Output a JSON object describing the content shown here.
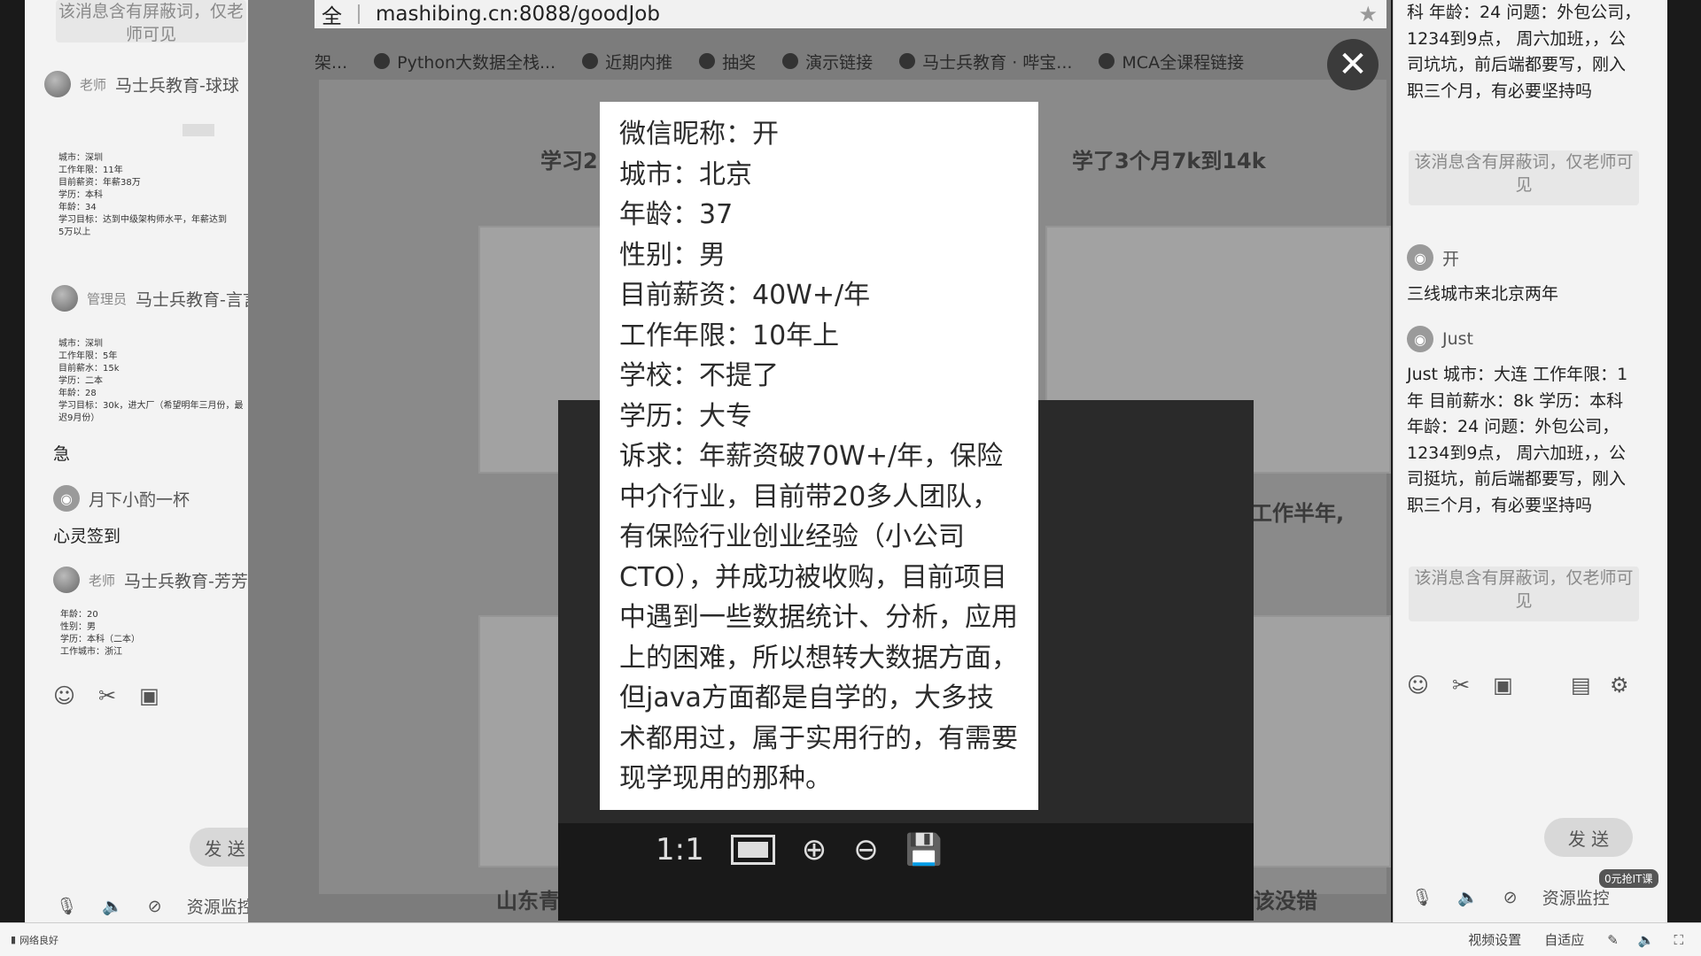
{
  "left_chat": {
    "top_blocked": "该消息含有屏蔽词，仅老师可见",
    "msg1": {
      "role": "老师",
      "name": "马士兵教育-球球"
    },
    "msg1_info": [
      "城市：深圳",
      "工作年限：11年",
      "目前薪资：年薪38万",
      "学历：本科",
      "年龄：34",
      "学习目标：达到中级架构师水平，年薪达到",
      "5万以上"
    ],
    "msg2": {
      "role": "管理员",
      "name": "马士兵教育-言言老..."
    },
    "msg2_info": [
      "城市：深圳",
      "工作年限：5年",
      "目前薪水：15k",
      "学历：二本",
      "年龄：28",
      "学习目标：30k，进大厂（希望明年三月份，最",
      "迟9月份）"
    ],
    "msg3_text": "急",
    "msg4": {
      "name": "月下小酌一杯",
      "text": "心灵签到"
    },
    "msg5": {
      "role": "老师",
      "name": "马士兵教育-芳芳老师..."
    },
    "msg5_info": [
      "年龄：20",
      "性别：男",
      "学历：本科（二本）",
      "工作城市：浙江"
    ],
    "send_label": "发 送",
    "bottom_label": "资源监控"
  },
  "browser": {
    "url": "mashibing.cn:8088/goodJob",
    "left_fragment": "全",
    "bookmarks": [
      "架...",
      "Python大数据全栈...",
      "近期内推",
      "抽奖",
      "演示链接",
      "马士兵教育 · 哔宝...",
      "MCA全课程链接"
    ],
    "ghost_title_left": "学习2",
    "ghost_title_right": "学了3个月7k到14k",
    "ghost_side": "工作半年,",
    "ghost_bottom_left": "山东青",
    "ghost_bottom_right": "该没错"
  },
  "info_card": {
    "lines": [
      "微信昵称：开",
      "城市：北京",
      "年龄：37",
      "性别：男",
      "目前薪资：40W+/年",
      "工作年限：10年上",
      "学校：不提了",
      "学历：大专"
    ],
    "demand": "诉求：年薪资破70W+/年，保险中介行业，目前带20多人团队，有保险行业创业经验（小公司CTO），并成功被收购，目前项目中遇到一些数据统计、分析，应用上的困难，所以想转大数据方面，但java方面都是自学的，大多技术都用过，属于实用行的，有需要现学现用的那种。"
  },
  "viewer": {
    "ratio_label": "1:1"
  },
  "right_chat": {
    "top_text": "科 年龄：24 问题：外包公司，1234到9点， 周六加班，，公司坑坑，前后端都要写，刚入职三个月，有必要坚持吗",
    "blocked1": "该消息含有屏蔽词，仅老师可见",
    "user1": "开",
    "user1_text": "三线城市来北京两年",
    "user2": "Just",
    "user2_text": "Just 城市：大连 工作年限：1年 目前薪水：8k 学历：本科 年龄：24 问题：外包公司，1234到9点， 周六加班，，公司挺坑，前后端都要写，刚入职三个月，有必要坚持吗",
    "blocked2": "该消息含有屏蔽词，仅老师可见",
    "send_label": "发 送",
    "badge": "0元抢IT课",
    "bottom_label": "资源监控"
  },
  "status_bar": {
    "network": "网络良好",
    "video_settings": "视频设置",
    "adaptive": "自适应"
  }
}
